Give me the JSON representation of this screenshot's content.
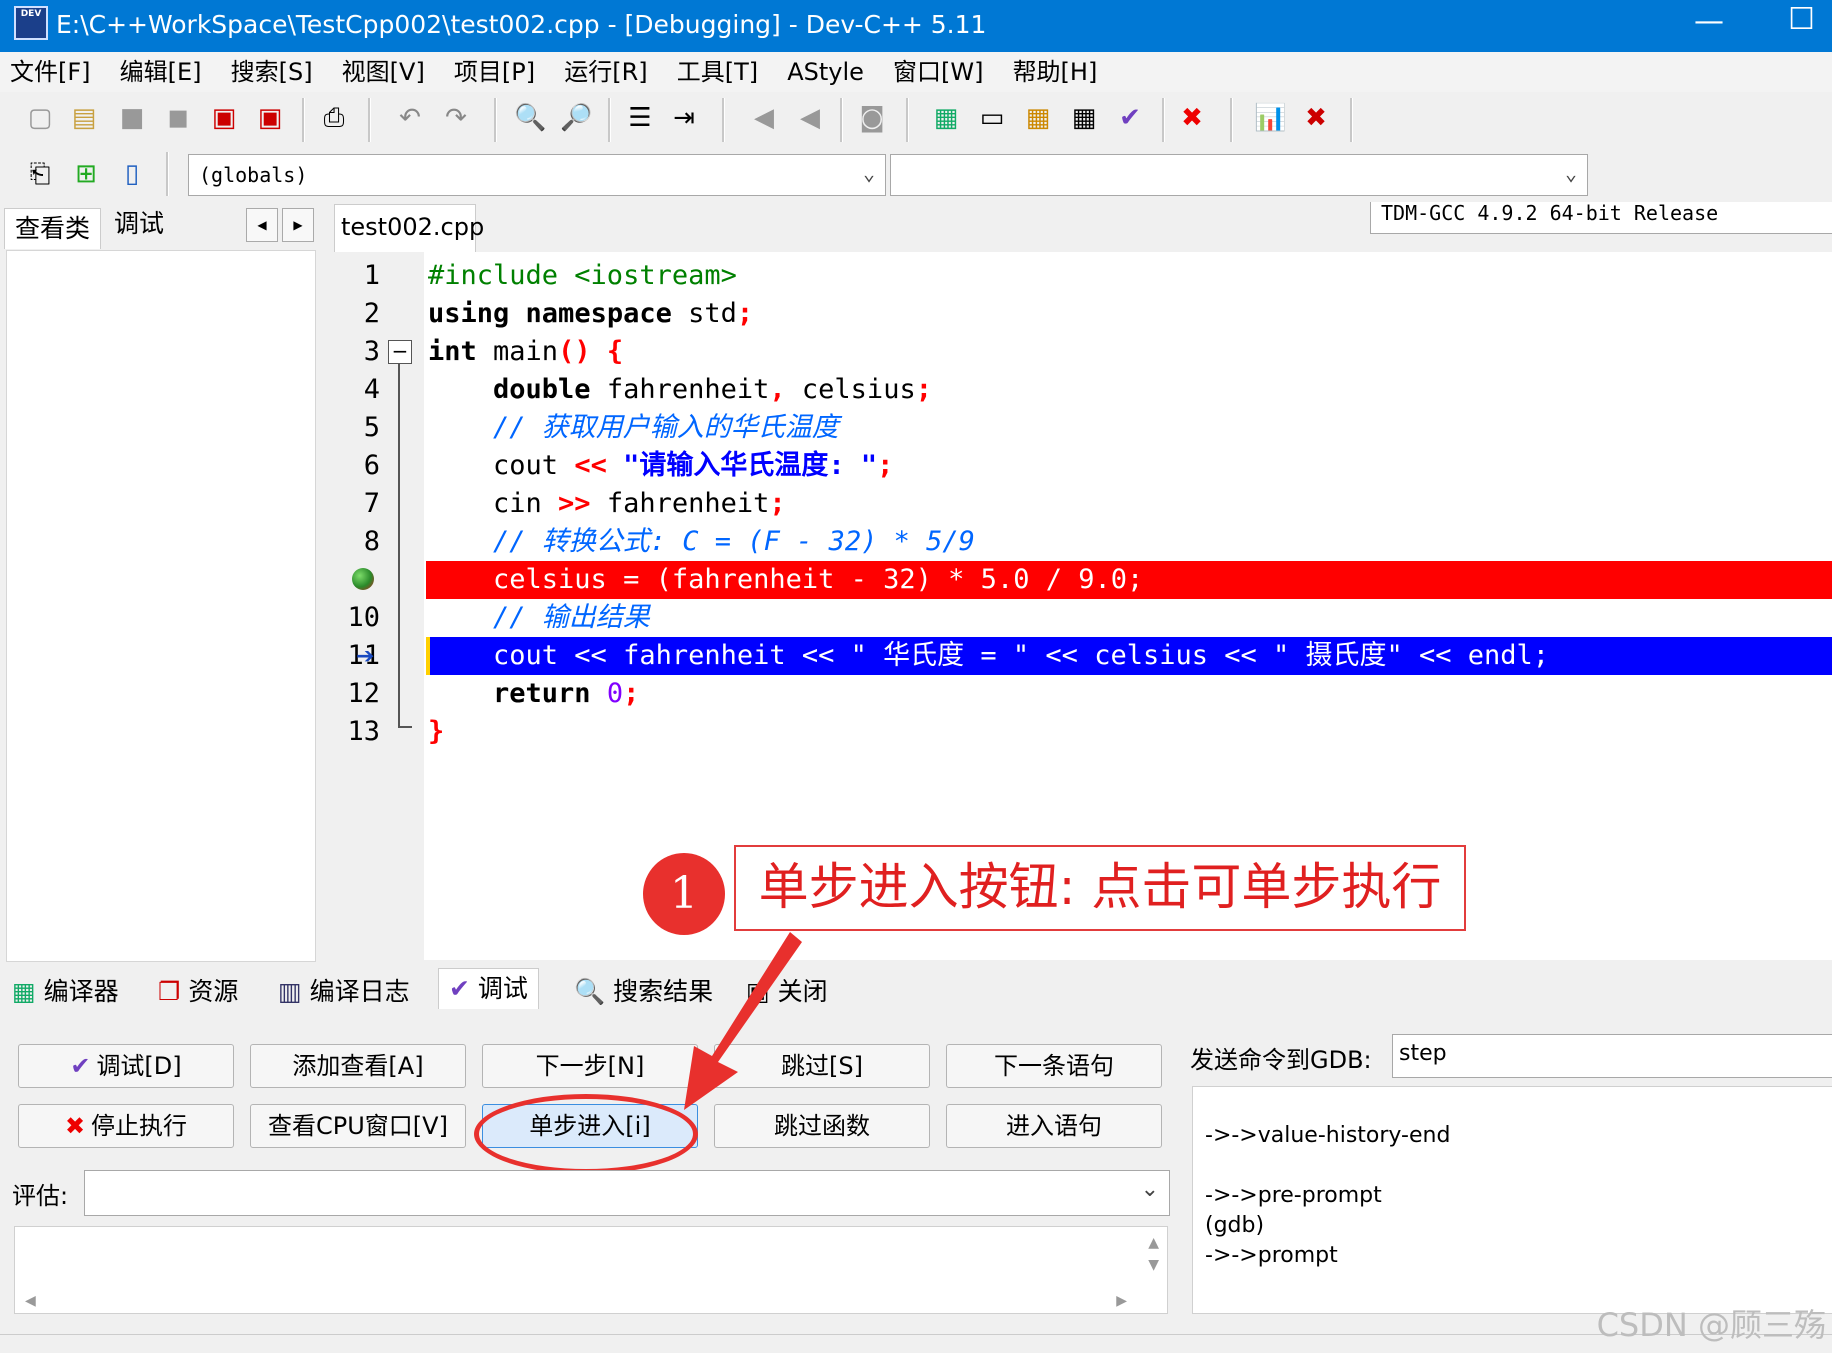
{
  "window": {
    "title": "E:\\C++WorkSpace\\TestCpp002\\test002.cpp - [Debugging] - Dev-C++ 5.11",
    "app_icon_text": "DEV",
    "minimize": "—",
    "maximize": "☐"
  },
  "menu": [
    "文件[F]",
    "编辑[E]",
    "搜索[S]",
    "视图[V]",
    "项目[P]",
    "运行[R]",
    "工具[T]",
    "AStyle",
    "窗口[W]",
    "帮助[H]"
  ],
  "toolbar": {
    "compiler_select": "TDM-GCC 4.9.2 64-bit Release",
    "scope_select": "(globals)",
    "function_select": ""
  },
  "left_panel": {
    "tabs": [
      "查看类",
      "调试"
    ],
    "nav_prev": "◀",
    "nav_next": "▶"
  },
  "editor": {
    "file_tab": "test002.cpp",
    "line_numbers": [
      "1",
      "2",
      "3",
      "4",
      "5",
      "6",
      "7",
      "8",
      "",
      "10",
      "11",
      "12",
      "13"
    ],
    "fold_marker": "⊟",
    "breakpoint_line": 9,
    "current_line": 11,
    "lines": {
      "l1_include": "#include <iostream>",
      "l2_using": "using",
      "l2_namespace": "namespace",
      "l2_std": " std",
      "l2_semi": ";",
      "l3_int": "int",
      "l3_main": " main",
      "l3_paren": "() {",
      "l4_indent": "    ",
      "l4_double": "double",
      "l4_vars": " fahrenheit",
      "l4_comma": ",",
      "l4_celsius": " celsius",
      "l4_semi": ";",
      "l5_comment": "    // 获取用户输入的华氏温度",
      "l6_cout": "    cout ",
      "l6_op": "<<",
      "l6_str": " \"请输入华氏温度: \"",
      "l6_semi": ";",
      "l7_cin": "    cin ",
      "l7_op": ">>",
      "l7_var": " fahrenheit",
      "l7_semi": ";",
      "l8_comment": "    // 转换公式: C = (F - 32) * 5/9",
      "l9_code": "    celsius = (fahrenheit - 32) * 5.0 / 9.0;",
      "l10_comment": "    // 输出结果",
      "l11_code": "    cout << fahrenheit << \" 华氏度 = \" << celsius << \" 摄氏度\" << endl;",
      "l12_return": "    return",
      "l12_zero": " 0",
      "l12_semi": ";",
      "l13_brace": "}"
    }
  },
  "bottom_tabs": [
    "编译器",
    "资源",
    "编译日志",
    "调试",
    "搜索结果",
    "关闭"
  ],
  "debug_buttons": {
    "debug": "调试[D]",
    "add_watch": "添加查看[A]",
    "next_step": "下一步[N]",
    "skip": "跳过[S]",
    "next_statement": "下一条语句",
    "stop": "停止执行",
    "cpu_window": "查看CPU窗口[V]",
    "step_into": "单步进入[i]",
    "skip_function": "跳过函数",
    "into_statement": "进入语句"
  },
  "gdb": {
    "label": "发送命令到GDB:",
    "command_value": "step",
    "output": [
      "->->value-history-end",
      "",
      "->->pre-prompt",
      "(gdb)",
      "->->prompt"
    ]
  },
  "evaluate": {
    "label": "评估:",
    "value": ""
  },
  "annotation": {
    "number": "1",
    "text": "单步进入按钮: 点击可单步执行"
  },
  "watermark": "CSDN @顾三殇",
  "colors": {
    "titlebar": "#0078d4",
    "breakpoint_line": "#ff0000",
    "current_line": "#0000ff",
    "annotation": "#e8302d"
  }
}
